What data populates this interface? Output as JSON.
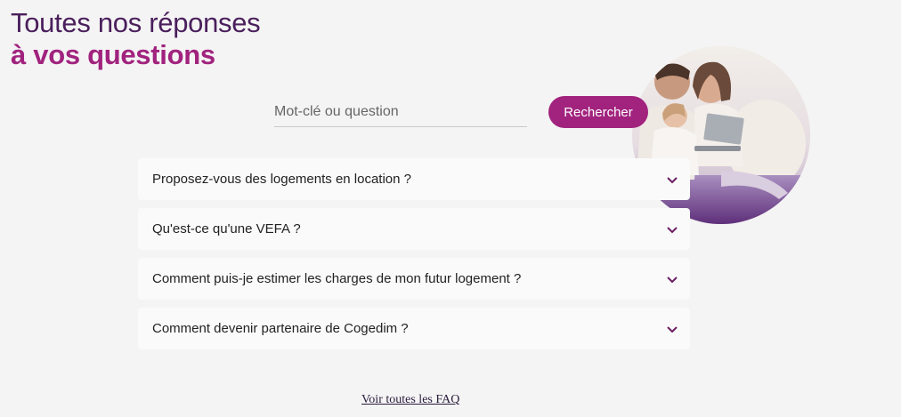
{
  "heading": {
    "line1": "Toutes nos réponses",
    "line2": "à vos questions"
  },
  "search": {
    "placeholder": "Mot-clé ou question",
    "button_label": "Rechercher"
  },
  "faq": {
    "items": [
      {
        "question": "Proposez-vous des logements en location ?"
      },
      {
        "question": "Qu'est-ce qu'une VEFA ?"
      },
      {
        "question": "Comment puis-je estimer les charges de mon futur logement ?"
      },
      {
        "question": "Comment devenir partenaire de Cogedim ?"
      }
    ],
    "view_all_label": "Voir toutes les FAQ"
  },
  "colors": {
    "accent": "#a1237e",
    "title_dark": "#4a1f5c",
    "background": "#f4f4f4"
  },
  "icons": {
    "expand": "chevron-down-icon"
  }
}
